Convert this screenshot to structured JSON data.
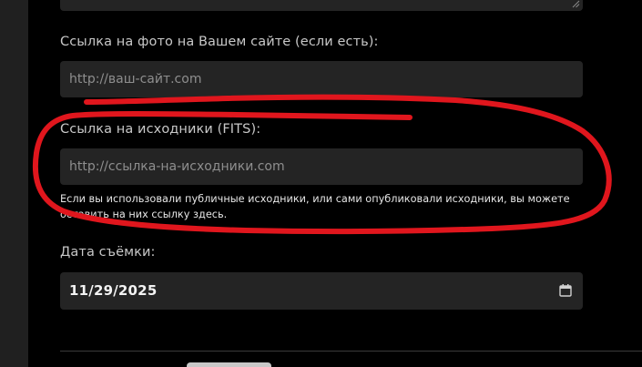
{
  "form": {
    "photo_link": {
      "label": "Ссылка на фото на Вашем сайте (если есть):",
      "placeholder": "http://ваш-сайт.com"
    },
    "sources_link": {
      "label": "Ссылка на исходники (FITS):",
      "placeholder": "http://ссылка-на-исходники.com",
      "hint": "Если вы использовали публичные исходники, или сами опубликовали исходники, вы можете оставить на них ссылку здесь."
    },
    "shoot_date": {
      "label": "Дата съёмки:",
      "value": "11/29/2025"
    }
  },
  "annotation": {
    "stroke_color": "#e0161d"
  },
  "colors": {
    "background": "#000000",
    "field_bg": "#242424",
    "label": "#c8c8c8",
    "placeholder": "#8e8e8e"
  }
}
